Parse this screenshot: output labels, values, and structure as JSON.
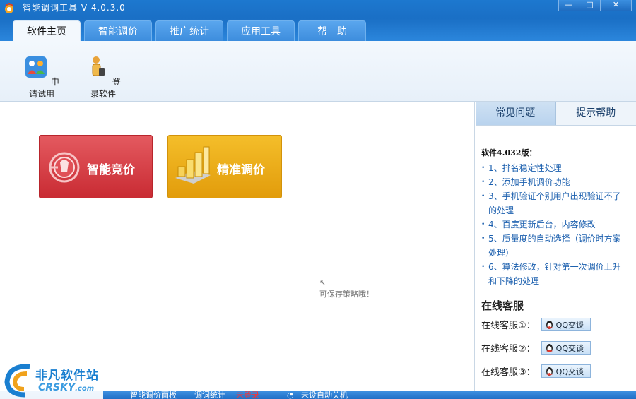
{
  "window": {
    "title": "智能调词工具  V 4.0.3.0",
    "minimize": "—",
    "maximize": "□",
    "close": "✕"
  },
  "tabs": [
    "软件主页",
    "智能调价",
    "推广统计",
    "应用工具",
    "帮　助"
  ],
  "toolbar": {
    "trial_label": "申请试用",
    "login_label": "登录软件"
  },
  "main": {
    "compete_label": "智能竞价",
    "precise_label": "精准调价",
    "save_hint": "可保存策略哦！"
  },
  "right_panel": {
    "tabs": [
      "常见问题",
      "提示帮助"
    ],
    "version_title": "软件4.032版：",
    "notes": [
      "1、排名稳定性处理",
      "2、添加手机调价功能",
      "3、手机验证个别用户出现验证不了的处理",
      "4、百度更新后台，内容修改",
      "5、质量度的自动选择（调价时方案处理）",
      "6、算法修改，针对第一次调价上升和下降的处理"
    ],
    "cs_title": "在线客服",
    "cs_rows": [
      {
        "label": "在线客服①：",
        "button": "QQ交谈"
      },
      {
        "label": "在线客服②：",
        "button": "QQ交谈"
      },
      {
        "label": "在线客服③：",
        "button": "QQ交谈"
      }
    ]
  },
  "statusbar": {
    "panel": "智能调价面板",
    "stats": "调词统计",
    "login_state": "未登录",
    "shutdown": "未设自动关机"
  },
  "watermark": {
    "cn": "非凡软件站",
    "en": "CRSKY",
    "en_suffix": ".com"
  },
  "colors": {
    "titlebar": "#1a6fc5",
    "compete": "#d23a41",
    "precise": "#eeaf1c",
    "note_link": "#1b5fae"
  }
}
